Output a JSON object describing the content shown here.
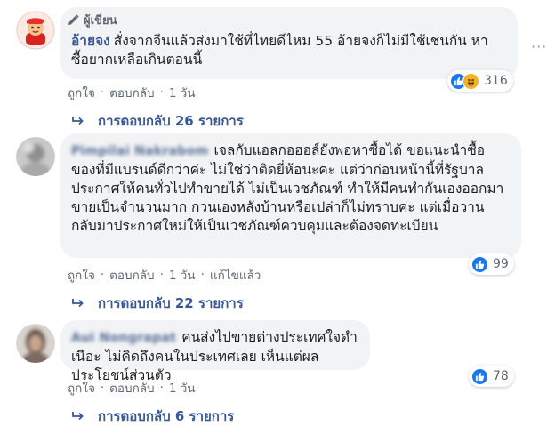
{
  "comments": [
    {
      "author_badge": "ผู้เขียน",
      "author": "อ้ายจง",
      "text": "สั่งจากจีนแล้วส่งมาใช้ที่ไทยดีไหม 55 อ้ายจงก็ไม่มีใช้เช่นกัน หาซื้อยากเหลือเกินตอนนี้",
      "reactions": [
        "like-icon",
        "haha-icon"
      ],
      "reaction_count": "316",
      "actions": [
        "ถูกใจ",
        "ตอบกลับ",
        "1 วัน"
      ],
      "replies": "การตอบกลับ 26 รายการ"
    },
    {
      "author": "Pimpilai Nakrabom",
      "text": "เจลกับแอลกอฮอล์ยังพอหาซื้อได้ ขอแนะนำซื้อของที่มีแบรนด์ดีกว่าค่ะ ไม่ใช่ว่าติดยี่ห้อนะคะ แต่ว่าก่อนหน้านี้ที่รัฐบาลประกาศให้คนทั่วไปทำขายได้ ไม่เป็นเวชภัณฑ์ ทำให้มีคนทำกันเองออกมาขายเป็นจำนวนมาก กวนเองหลังบ้านหรือเปล่าก็ไม่ทราบค่ะ แต่เมื่อวานกลับมาประกาศใหม่ให้เป็นเวชภัณฑ์ควบคุมและต้องจดทะเบียน",
      "reactions": [
        "like-icon"
      ],
      "reaction_count": "99",
      "actions": [
        "ถูกใจ",
        "ตอบกลับ",
        "1 วัน",
        "แก้ไขแล้ว"
      ],
      "replies": "การตอบกลับ 22 รายการ"
    },
    {
      "author": "Aui Nongrapat",
      "text": "คนส่งไปขายต่างประเทศใจดำเนือะ ไม่คิดถึงคนในประเทศเลย เห็นแต่ผลประโยชน์ส่วนตัว",
      "reactions": [
        "like-icon"
      ],
      "reaction_count": "78",
      "actions": [
        "ถูกใจ",
        "ตอบกลับ",
        "1 วัน"
      ],
      "replies": "การตอบกลับ 6 รายการ"
    }
  ],
  "more_options": "···",
  "colors": {
    "link": "#385898",
    "bubble": "#f2f3f5",
    "meta": "#606770",
    "like": "#1877f2",
    "haha": "#f7b125"
  }
}
